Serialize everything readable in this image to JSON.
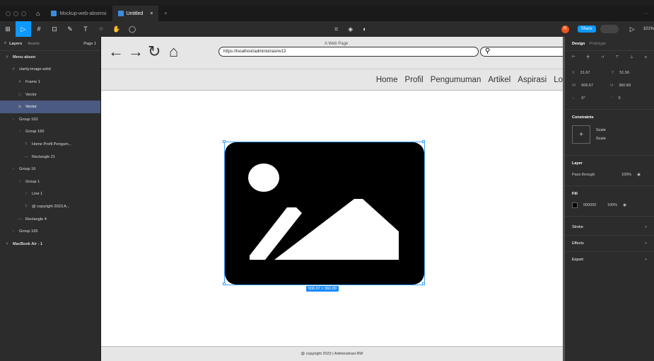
{
  "tabs": {
    "home_icon": "home-icon",
    "tab1": "Mockup-web-absensi",
    "tab2": "Untitled",
    "close": "×",
    "add": "+"
  },
  "toolbar": {
    "zoom": "101%",
    "share": "Share",
    "avatar": "R",
    "play": "▷"
  },
  "left_panel": {
    "tab_layers": "Layers",
    "tab_assets": "Assets",
    "page": "Page 1",
    "layers": [
      {
        "label": "Menu absen",
        "indent": 0,
        "icon": "#"
      },
      {
        "label": "clarity:image-solid",
        "indent": 1,
        "icon": "#"
      },
      {
        "label": "Frame 1",
        "indent": 2,
        "icon": "#"
      },
      {
        "label": "Vector",
        "indent": 2,
        "icon": "□"
      },
      {
        "label": "Vector",
        "indent": 2,
        "icon": "▣",
        "selected": true
      },
      {
        "label": "Group 163",
        "indent": 1,
        "icon": "▫"
      },
      {
        "label": "Group 160",
        "indent": 2,
        "icon": "▫"
      },
      {
        "label": "Home Profil Pengum...",
        "indent": 3,
        "icon": "T"
      },
      {
        "label": "Rectangle 21",
        "indent": 3,
        "icon": "—"
      },
      {
        "label": "Group 16",
        "indent": 1,
        "icon": "▫"
      },
      {
        "label": "Group 1",
        "indent": 2,
        "icon": "▫"
      },
      {
        "label": "Line 1",
        "indent": 3,
        "icon": "/"
      },
      {
        "label": "@ copyright 2023 A...",
        "indent": 3,
        "icon": "T"
      },
      {
        "label": "Rectangle 4",
        "indent": 2,
        "icon": "—"
      },
      {
        "label": "Group 165",
        "indent": 1,
        "icon": "▫"
      },
      {
        "label": "MacBook Air - 1",
        "indent": 0,
        "icon": "#"
      }
    ]
  },
  "mockup": {
    "window_title": "A Web Page",
    "url": "https://localhost/administrasirw13",
    "menu": [
      "Home",
      "Profil",
      "Pengumuman",
      "Artikel",
      "Aspirasi",
      "Lo"
    ],
    "footer": "@ copyright 2023 | Administrasi RW",
    "dimensions": "506.67 × 360.89"
  },
  "right_panel": {
    "tab_design": "Design",
    "tab_prototype": "Prototype",
    "x_label": "X",
    "x": "31.67",
    "y_label": "Y",
    "y": "51.56",
    "w_label": "W",
    "w": "506.67",
    "h_label": "H",
    "h": "360.89",
    "rotation": "0°",
    "radius": "0",
    "constraints": "Constraints",
    "scale1": "Scale",
    "scale2": "Scale",
    "layer": "Layer",
    "blend": "Pass through",
    "opacity": "100%",
    "fill": "Fill",
    "fill_hex": "000000",
    "fill_opacity": "100%",
    "stroke": "Stroke",
    "effects": "Effects",
    "export": "Export"
  },
  "colors": {
    "accent": "#0d99ff",
    "panel": "#2c2c2c",
    "selected_layer": "#4a5a82"
  }
}
